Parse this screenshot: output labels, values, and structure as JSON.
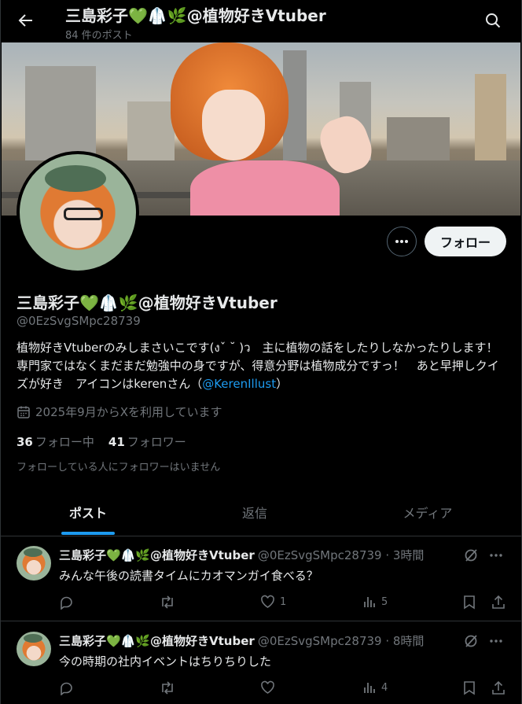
{
  "header": {
    "title": "三島彩子💚🥼🌿@植物好きVtuber",
    "post_count": "84 件のポスト"
  },
  "profile": {
    "display_name": "三島彩子💚🥼🌿@植物好きVtuber",
    "handle": "@0EzSvgSMpc28739",
    "bio_text": "植物好きVtuberのみしまさいこです(งˇ ˘ )ว　主に植物の話をしたりしなかったりします！　専門家ではなくまだまだ勉強中の身ですが、得意分野は植物成分ですっ！　あと早押しクイズが好き　アイコンはkerenさん（",
    "bio_mention": "@KerenIllust",
    "bio_end": "）",
    "joined": "2025年9月からXを利用しています",
    "following_count": "36",
    "following_label": "フォロー中",
    "followers_count": "41",
    "followers_label": "フォロワー",
    "followed_note": "フォローしている人にフォロワーはいません",
    "follow_button": "フォロー"
  },
  "tabs": [
    {
      "label": "ポスト",
      "active": true
    },
    {
      "label": "返信",
      "active": false
    },
    {
      "label": "メディア",
      "active": false
    }
  ],
  "posts": [
    {
      "name": "三島彩子💚🥼🌿@植物好きVtuber",
      "handle_time": "@0EzSvgSMpc28739 · 3時間",
      "text": "みんな午後の読書タイムにカオマンガイ食べる？",
      "replies": "",
      "reposts": "",
      "likes": "1",
      "views": "5"
    },
    {
      "name": "三島彩子💚🥼🌿@植物好きVtuber",
      "handle_time": "@0EzSvgSMpc28739 · 8時間",
      "text": "今の時期の社内イベントはちりちりした",
      "replies": "",
      "reposts": "",
      "likes": "",
      "views": "4"
    }
  ],
  "icons": {
    "back": "arrow-left-icon",
    "search": "search-icon",
    "more": "ellipsis-icon",
    "calendar": "calendar-icon",
    "reply": "reply-icon",
    "repost": "repost-icon",
    "like": "heart-icon",
    "views": "views-icon",
    "bookmark": "bookmark-icon",
    "share": "share-icon",
    "grok": "grok-icon"
  },
  "colors": {
    "accent": "#1d9bf0",
    "muted": "#71767b",
    "text": "#e7e9ea",
    "background": "#000000"
  }
}
